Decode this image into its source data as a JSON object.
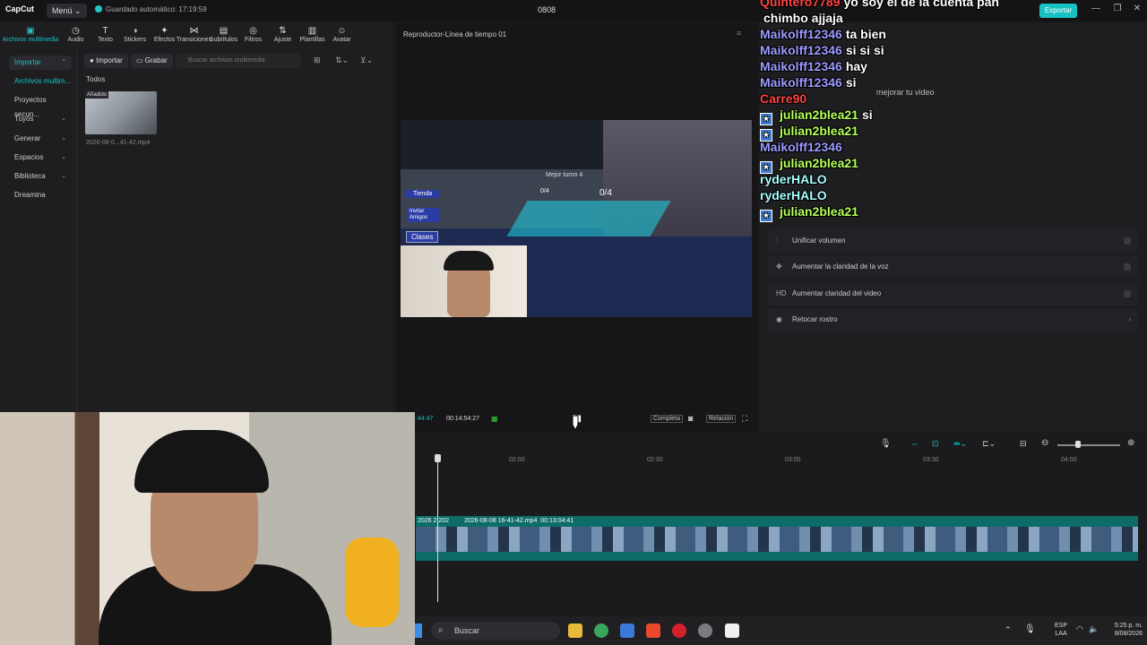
{
  "topbar": {
    "app": "CapCut",
    "menu": "Menú",
    "autosave": "Guardado automático: 17:19:59",
    "project": "0808",
    "export": "Exportar",
    "min": "—",
    "max": "❐",
    "close": "✕"
  },
  "tooltabs": [
    {
      "icon": "▣",
      "label": "Archivos multimedia",
      "active": true
    },
    {
      "icon": "◷",
      "label": "Audio"
    },
    {
      "icon": "T",
      "label": "Texto"
    },
    {
      "icon": "◑",
      "label": "Stickers"
    },
    {
      "icon": "✦",
      "label": "Efectos"
    },
    {
      "icon": "⋈",
      "label": "Transiciones"
    },
    {
      "icon": "▤",
      "label": "Subtítulos"
    },
    {
      "icon": "◎",
      "label": "Filtros"
    },
    {
      "icon": "⇅",
      "label": "Ajuste"
    },
    {
      "icon": "▥",
      "label": "Plantillas"
    },
    {
      "icon": "☺",
      "label": "Avatar"
    }
  ],
  "leftnav": [
    {
      "label": "Importar",
      "selected": true,
      "chev": "⌃"
    },
    {
      "label": "Archivos multim...",
      "selected": false,
      "accent": true
    },
    {
      "label": "Proyectos secun...",
      "selected": false
    },
    {
      "label": "Tuyos",
      "chev": "⌄"
    },
    {
      "label": "Generar",
      "chev": "⌄"
    },
    {
      "label": "Espacios",
      "chev": "⌄"
    },
    {
      "label": "Biblioteca",
      "chev": "⌄"
    },
    {
      "label": "Dreamina"
    }
  ],
  "media": {
    "import": "Importar",
    "record": "Grabar",
    "search_placeholder": "Buscar archivos multimedia",
    "all": "Todos",
    "thumb_badge": "Añadido",
    "thumb_name": "2026-08-0...41-42.mp4"
  },
  "player": {
    "title": "Reproductor-Línea de tiempo 01",
    "time_current": "1:44:47",
    "time_total": "00:14:54:27",
    "complete": "Completa",
    "ratio": "Relación",
    "overlay_text": "Mejor turno 4",
    "score_left": "0/4",
    "score_right": "0/4",
    "shop": "Tienda",
    "invite": "Invitar Amigos",
    "classes": "Clases"
  },
  "rightpanel": {
    "improve": "mejorar tu video",
    "items": [
      {
        "icon": "⫶",
        "label": "Unificar volumen"
      },
      {
        "icon": "✥",
        "label": "Aumentar la claridad de la voz"
      },
      {
        "icon": "HD",
        "label": "Aumentar claridad del video"
      },
      {
        "icon": "◉",
        "label": "Retocar rostro"
      }
    ]
  },
  "timeline": {
    "ticks": [
      "02:00",
      "02:30",
      "03:00",
      "03:30",
      "04:00"
    ],
    "clip_label": "2026-08-08 16-41-42.mp4",
    "clip_duration": "00:13:04:41",
    "clip_prefix": "2026 2 202"
  },
  "taskbar": {
    "search": "Buscar",
    "lang_top": "ESP",
    "lang_bottom": "LAA",
    "time": "5:25 p. m.",
    "date": "8/08/2026"
  },
  "chat": [
    {
      "user": "Quintero7789",
      "msg": "yo soy el de la cuenta pan",
      "color": "#ff4444"
    },
    {
      "user": "",
      "msg": "chimbo ajjaja",
      "color": "#ffffff"
    },
    {
      "user": "Maikolff12346",
      "msg": "ta bien",
      "color": "#9b9bff"
    },
    {
      "user": "Maikolff12346",
      "msg": "si si si",
      "color": "#9b9bff"
    },
    {
      "user": "Maikolff12346",
      "msg": "hay",
      "color": "#9b9bff"
    },
    {
      "user": "Maikolff12346",
      "msg": "si",
      "color": "#9b9bff"
    },
    {
      "user": "Carre90",
      "msg": "",
      "color": "#ff4444"
    },
    {
      "user": "julian2blea21",
      "msg": "si",
      "color": "#b6ff5a",
      "badge": true
    },
    {
      "user": "julian2blea21",
      "msg": "",
      "color": "#b6ff5a",
      "badge": true
    },
    {
      "user": "Maikolff12346",
      "msg": "",
      "color": "#9b9bff"
    },
    {
      "user": "julian2blea21",
      "msg": "",
      "color": "#b6ff5a",
      "badge": true
    },
    {
      "user": "ryderHALO",
      "msg": "",
      "color": "#a8ffff"
    },
    {
      "user": "ryderHALO",
      "msg": "",
      "color": "#a8ffff"
    },
    {
      "user": "julian2blea21",
      "msg": "",
      "color": "#b6ff5a",
      "badge": true
    }
  ],
  "colors": {
    "accent": "#19c2c2",
    "track": "#0d6b68"
  }
}
